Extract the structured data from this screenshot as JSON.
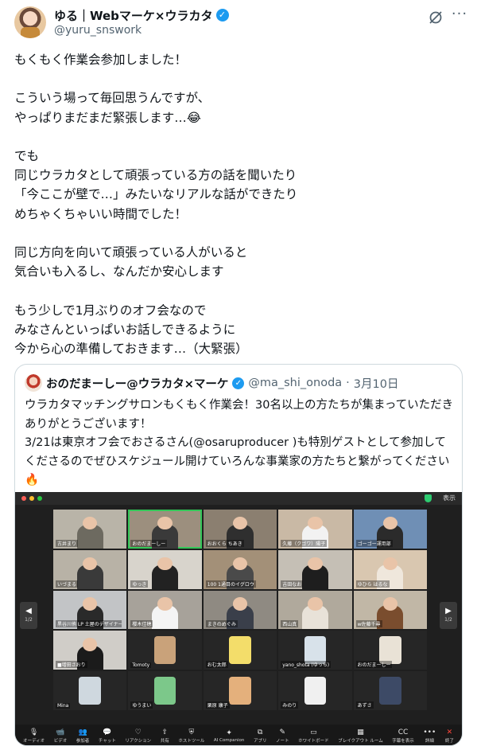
{
  "author": {
    "name": "ゆる｜Webマーケ×ウラカタ",
    "handle": "@yuru_snswork"
  },
  "icons": {
    "verified": "✓",
    "grok": "grok-icon",
    "more": "···"
  },
  "tweet_text": "もくもく作業会参加しました！\n\nこういう場って毎回思うんですが、\nやっぱりまだまだ緊張します…😂\n\nでも\n同じウラカタとして頑張っている方の話を聞いたり\n「今ここが壁で…」みたいなリアルな話ができたり\nめちゃくちゃいい時間でした！\n\n同じ方向を向いて頑張っている人がいると\n気合いも入るし、なんだか安心します\n\nもう少しで1月ぶりのオフ会なので\nみなさんといっぱいお話しできるように\n今から心の準備しておきます…（大緊張）",
  "quote": {
    "name": "おのだまーしー@ウラカタ×マーケ",
    "handle": "@ma_shi_onoda",
    "separator": "·",
    "date": "3月10日",
    "text": "ウラカタマッチングサロンもくもく作業会！30名以上の方たちが集まっていただきありがとうございます！\n3/21は東京オフ会でおさるさん(@osaruproducer )も特別ゲストとして参加してくださるのでぜひスケジュール開けていろんな事業家の方たちと繋がってください🔥"
  },
  "zoom": {
    "view_label": "表示",
    "page_left": "1/2",
    "page_right": "1/2",
    "tiles": [
      {
        "label": "古井まり",
        "bg": "#b9b4a8",
        "shirt": "#6d6a60"
      },
      {
        "label": "おのだまーしー",
        "bg": "#9c8f7e",
        "shirt": "#3a3a3a",
        "active": true
      },
      {
        "label": "おおくら ちあき",
        "bg": "#8b7f70",
        "shirt": "#2f2f2f"
      },
      {
        "label": "久藤（クゴワ）陽子",
        "bg": "#c9b9a5",
        "shirt": "#f2f2f2"
      },
      {
        "label": "ゴーゴー運用部",
        "bg": "#6f8fb5",
        "shirt": "#2b2b2b"
      },
      {
        "label": "いづまる",
        "bg": "#b8b2a6",
        "shirt": "#3a3a3a"
      },
      {
        "label": "ゆっき",
        "bg": "#d8d4cc",
        "shirt": "#222"
      },
      {
        "label": "100 1通目のイグロウ",
        "bg": "#a39078",
        "shirt": "#4a4a4a"
      },
      {
        "label": "吉田なお",
        "bg": "#c5bfb5",
        "shirt": "#1e1e1e"
      },
      {
        "label": "ゆひら はるな",
        "bg": "#d9c7b0",
        "shirt": "#efe7dc"
      },
      {
        "label": "黒谷川侑 LP 土屋のデザイナー",
        "bg": "#c2c4c6",
        "shirt": "#2a2a2a"
      },
      {
        "label": "櫻木佳穂",
        "bg": "#a7a29a",
        "shirt": "#f4f4f4"
      },
      {
        "label": "まきのめぐみ",
        "bg": "#8f8a82",
        "shirt": "#3a3f4a"
      },
      {
        "label": "西山真",
        "bg": "#b0a99c",
        "shirt": "#e8e2d8"
      },
      {
        "label": "w佐藤千尋",
        "bg": "#c1b7a6",
        "shirt": "#7a4d2e"
      },
      {
        "label": "■増田さおり",
        "bg": "#d0cdc8",
        "shirt": "#1b1b1b"
      },
      {
        "label": "Tomoty",
        "dark": true,
        "pic": "#c9a27a"
      },
      {
        "label": "おむ太郎",
        "dark": true,
        "pic": "#f3dd6a"
      },
      {
        "label": "yano_shota (ゆっち)",
        "dark": true,
        "pic": "#d8e2ea"
      },
      {
        "label": "おのだまーしー",
        "dark": true,
        "pic": "#e9e2d6"
      },
      {
        "label": "Mina",
        "dark": true,
        "pic": "#cfd8df"
      },
      {
        "label": "ゆうまい",
        "dark": true,
        "pic": "#7cc88a"
      },
      {
        "label": "栗原 康子",
        "dark": true,
        "pic": "#e4b07c"
      },
      {
        "label": "みのり",
        "dark": true,
        "pic": "#f0f0f0"
      },
      {
        "label": "あずさ",
        "dark": true,
        "pic": "#3d4a66"
      }
    ],
    "toolbar": [
      {
        "icon": "🎙",
        "label": "オーディオ"
      },
      {
        "icon": "📹",
        "label": "ビデオ"
      },
      {
        "icon": "👥",
        "label": "参加者"
      },
      {
        "icon": "💬",
        "label": "チャット"
      },
      {
        "icon": "♡",
        "label": "リアクション"
      },
      {
        "icon": "⇧",
        "label": "共有"
      },
      {
        "icon": "⛨",
        "label": "ホストツール"
      },
      {
        "icon": "✦",
        "label": "AI Companion"
      },
      {
        "icon": "⧉",
        "label": "アプリ"
      },
      {
        "icon": "✎",
        "label": "ノート"
      },
      {
        "icon": "▭",
        "label": "ホワイトボード"
      },
      {
        "icon": "▦",
        "label": "ブレイクアウト ルーム"
      },
      {
        "icon": "CC",
        "label": "字幕を表示"
      },
      {
        "icon": "•••",
        "label": "詳細"
      },
      {
        "icon": "✕",
        "label": "終了",
        "end": true
      }
    ],
    "dot_colors": [
      "#ff5f57",
      "#febc2e",
      "#28c840"
    ]
  }
}
